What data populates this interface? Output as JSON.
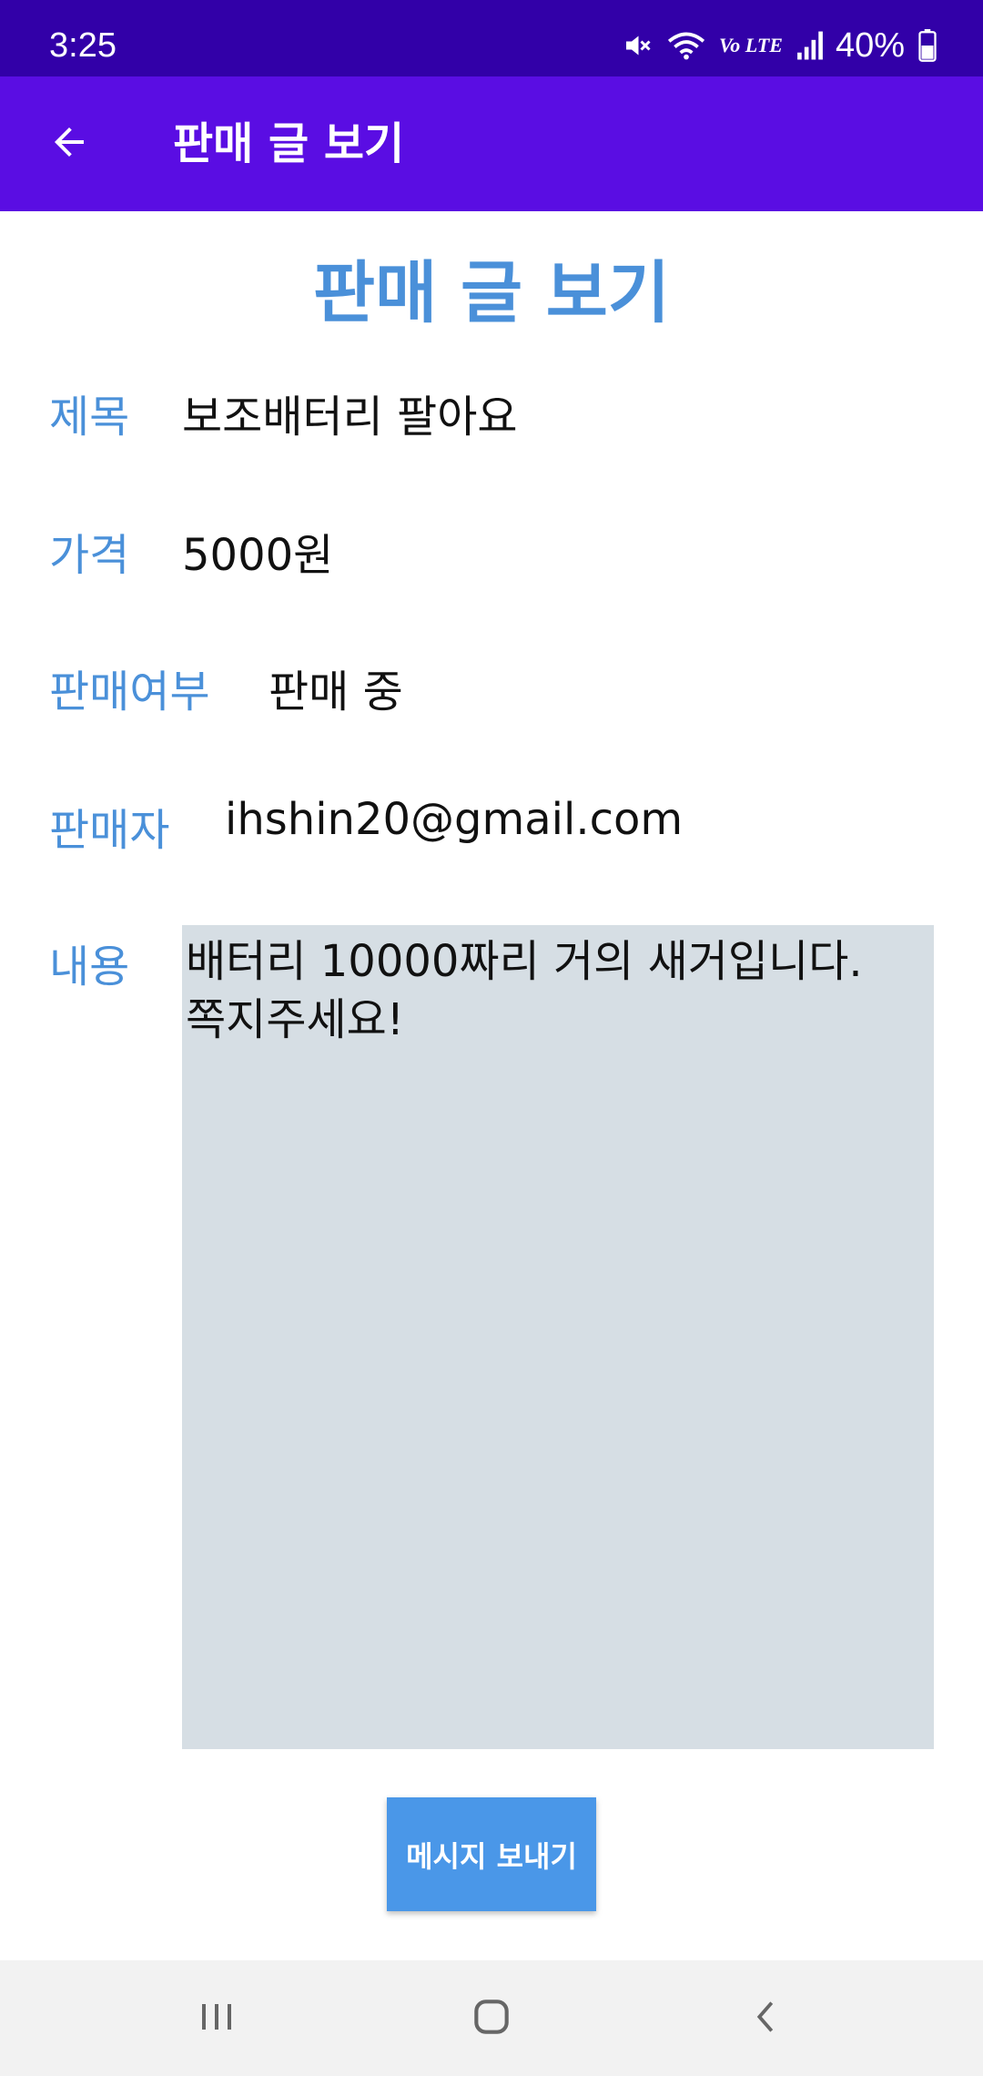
{
  "status_bar": {
    "time": "3:25",
    "battery_percent": "40%",
    "network_label": "Vo LTE",
    "icons": [
      "mute-icon",
      "wifi-icon",
      "volte-icon",
      "signal-icon",
      "battery-icon"
    ]
  },
  "app_bar": {
    "title": "판매 글 보기",
    "back_icon": "arrow-left-icon"
  },
  "page": {
    "heading": "판매 글 보기"
  },
  "fields": {
    "title": {
      "label": "제목",
      "value": "보조배터리 팔아요"
    },
    "price": {
      "label": "가격",
      "value": "5000원"
    },
    "sale_status": {
      "label": "판매여부",
      "value": "판매 중"
    },
    "seller": {
      "label": "판매자",
      "value": "ihshin20@gmail.com"
    },
    "content": {
      "label": "내용",
      "value": "배터리 10000짜리 거의 새거입니다.\n쪽지주세요!"
    }
  },
  "actions": {
    "send_message_label": "메시지 보내기"
  },
  "nav_bar": {
    "icons": [
      "recent-apps-icon",
      "home-icon",
      "back-icon"
    ]
  },
  "colors": {
    "status_bar": "#3200a8",
    "app_bar": "#5a0de3",
    "accent_label": "#4a90d9",
    "content_bg": "#d6dee4",
    "button_bg": "#4a97e8",
    "nav_bar": "#f2f2f2"
  }
}
